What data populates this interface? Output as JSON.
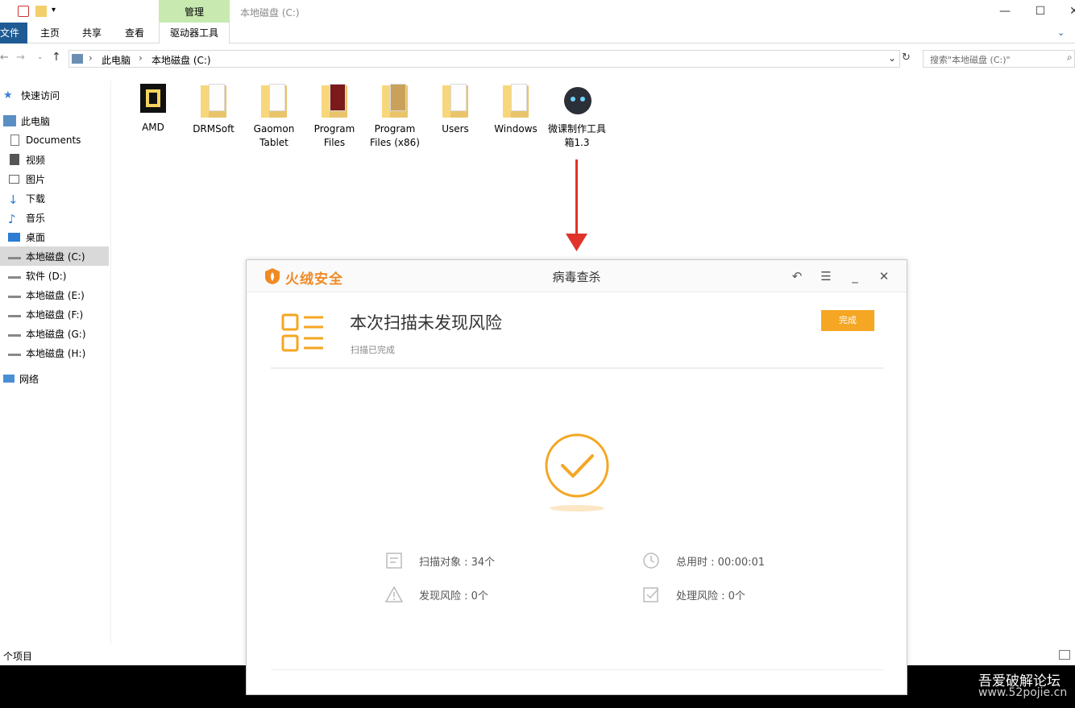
{
  "window": {
    "title": "本地磁盘 (C:)",
    "context_tab": "管理"
  },
  "ribbon": {
    "tabs": [
      "文件",
      "主页",
      "共享",
      "查看",
      "驱动器工具"
    ]
  },
  "address": {
    "segments": [
      "此电脑",
      "本地磁盘 (C:)"
    ],
    "search_placeholder": "搜索\"本地磁盘 (C:)\""
  },
  "sidebar": {
    "items": [
      {
        "label": "快速访问",
        "icon": "star-icon"
      },
      {
        "label": "此电脑",
        "icon": "computer-icon"
      },
      {
        "label": "Documents",
        "icon": "document-icon"
      },
      {
        "label": "视频",
        "icon": "video-icon"
      },
      {
        "label": "图片",
        "icon": "picture-icon"
      },
      {
        "label": "下载",
        "icon": "download-icon"
      },
      {
        "label": "音乐",
        "icon": "music-icon"
      },
      {
        "label": "桌面",
        "icon": "desktop-icon"
      },
      {
        "label": "本地磁盘 (C:)",
        "icon": "drive-icon"
      },
      {
        "label": "软件 (D:)",
        "icon": "drive-icon"
      },
      {
        "label": "本地磁盘 (E:)",
        "icon": "drive-icon"
      },
      {
        "label": "本地磁盘 (F:)",
        "icon": "drive-icon"
      },
      {
        "label": "本地磁盘 (G:)",
        "icon": "drive-icon"
      },
      {
        "label": "本地磁盘 (H:)",
        "icon": "drive-icon"
      },
      {
        "label": "网络",
        "icon": "network-icon"
      }
    ]
  },
  "files": [
    {
      "name": "AMD"
    },
    {
      "name": "DRMSoft"
    },
    {
      "name": "Gaomon Tablet"
    },
    {
      "name": "Program Files"
    },
    {
      "name": "Program Files (x86)"
    },
    {
      "name": "Users"
    },
    {
      "name": "Windows"
    },
    {
      "name": "微课制作工具箱1.3"
    }
  ],
  "status": {
    "text": "个项目"
  },
  "dialog": {
    "brand": "火绒安全",
    "title": "病毒查杀",
    "result_title": "本次扫描未发现风险",
    "result_subtitle": "扫描已完成",
    "done_button": "完成",
    "stats": {
      "scanned": "扫描对象 : 34个",
      "duration": "总用时 : 00:00:01",
      "risks_found": "发现风险 : 0个",
      "risks_handled": "处理风险 : 0个"
    },
    "accent_color": "#f5a623"
  },
  "watermark": {
    "line1": "吾爱破解论坛",
    "line2": "www.52pojie.cn"
  }
}
